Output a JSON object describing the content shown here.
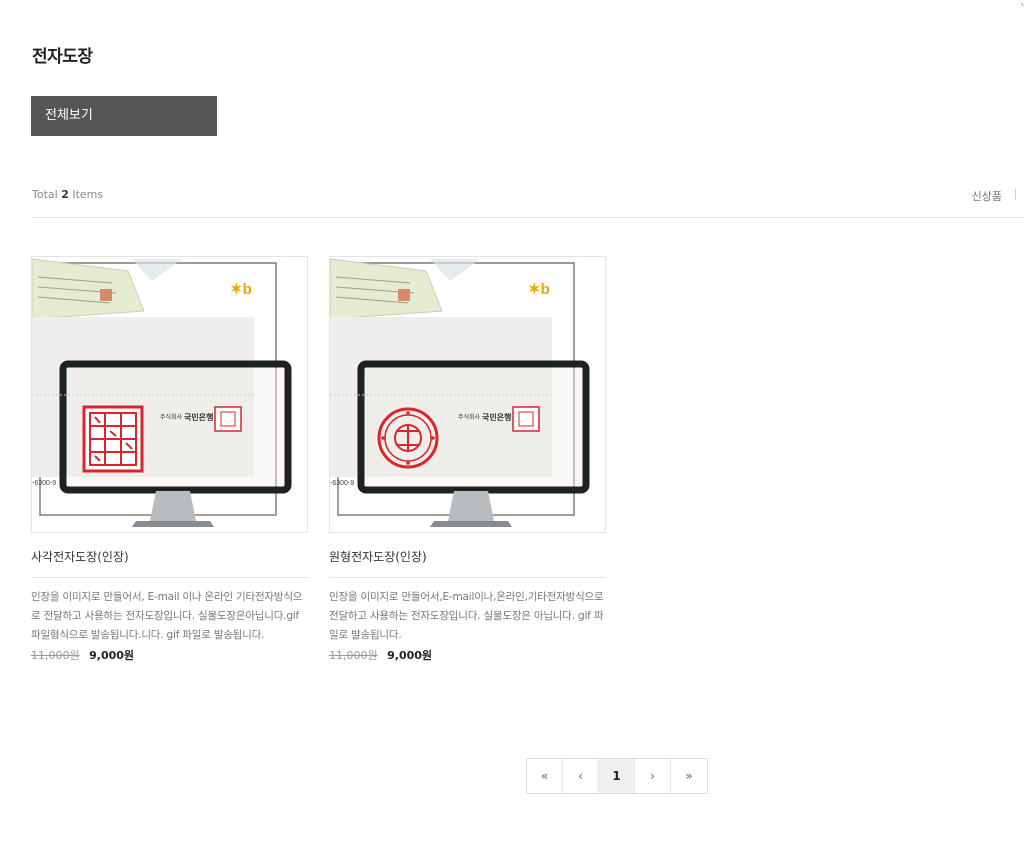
{
  "page": {
    "title": "전자도장"
  },
  "category": {
    "all_label": "전체보기"
  },
  "list": {
    "total_prefix": "Total",
    "total_count": "2",
    "total_suffix": "Items",
    "sort_label": "신상품"
  },
  "products": [
    {
      "name": "사각전자도장(인장)",
      "description": "인장을 이미지로 만들어서, E-mail 이나 온라인 기타전자방식으로 전달하고 사용하는 전자도장입니다. 실물도장은아닙니다.gif파일형식으로 발송됩니다.니다. gif 파일로 발송됩니다.",
      "original_price": "11,000원",
      "sale_price": "9,000원",
      "thumb": {
        "company_label": "주식회사",
        "bank_label": "국민은행",
        "seal_style": "square",
        "bottom_text": "-6300-9"
      }
    },
    {
      "name": "원형전자도장(인장)",
      "description": "인장을 이미지로 만들어서,E-mail이나,온라인,기타전자방식으로 전달하고 사용하는 전자도장입니다. 실물도장은 아닙니다. gif 파일로 발송됩니다.",
      "original_price": "11,000원",
      "sale_price": "9,000원",
      "thumb": {
        "company_label": "주식회사",
        "bank_label": "국민은행",
        "seal_style": "round",
        "bottom_text": "-6300-9"
      }
    }
  ],
  "pagination": {
    "first": "«",
    "prev": "‹",
    "current": "1",
    "next": "›",
    "last": "»"
  },
  "colors": {
    "seal_red": "#d9262b",
    "button_bg": "#555555"
  }
}
